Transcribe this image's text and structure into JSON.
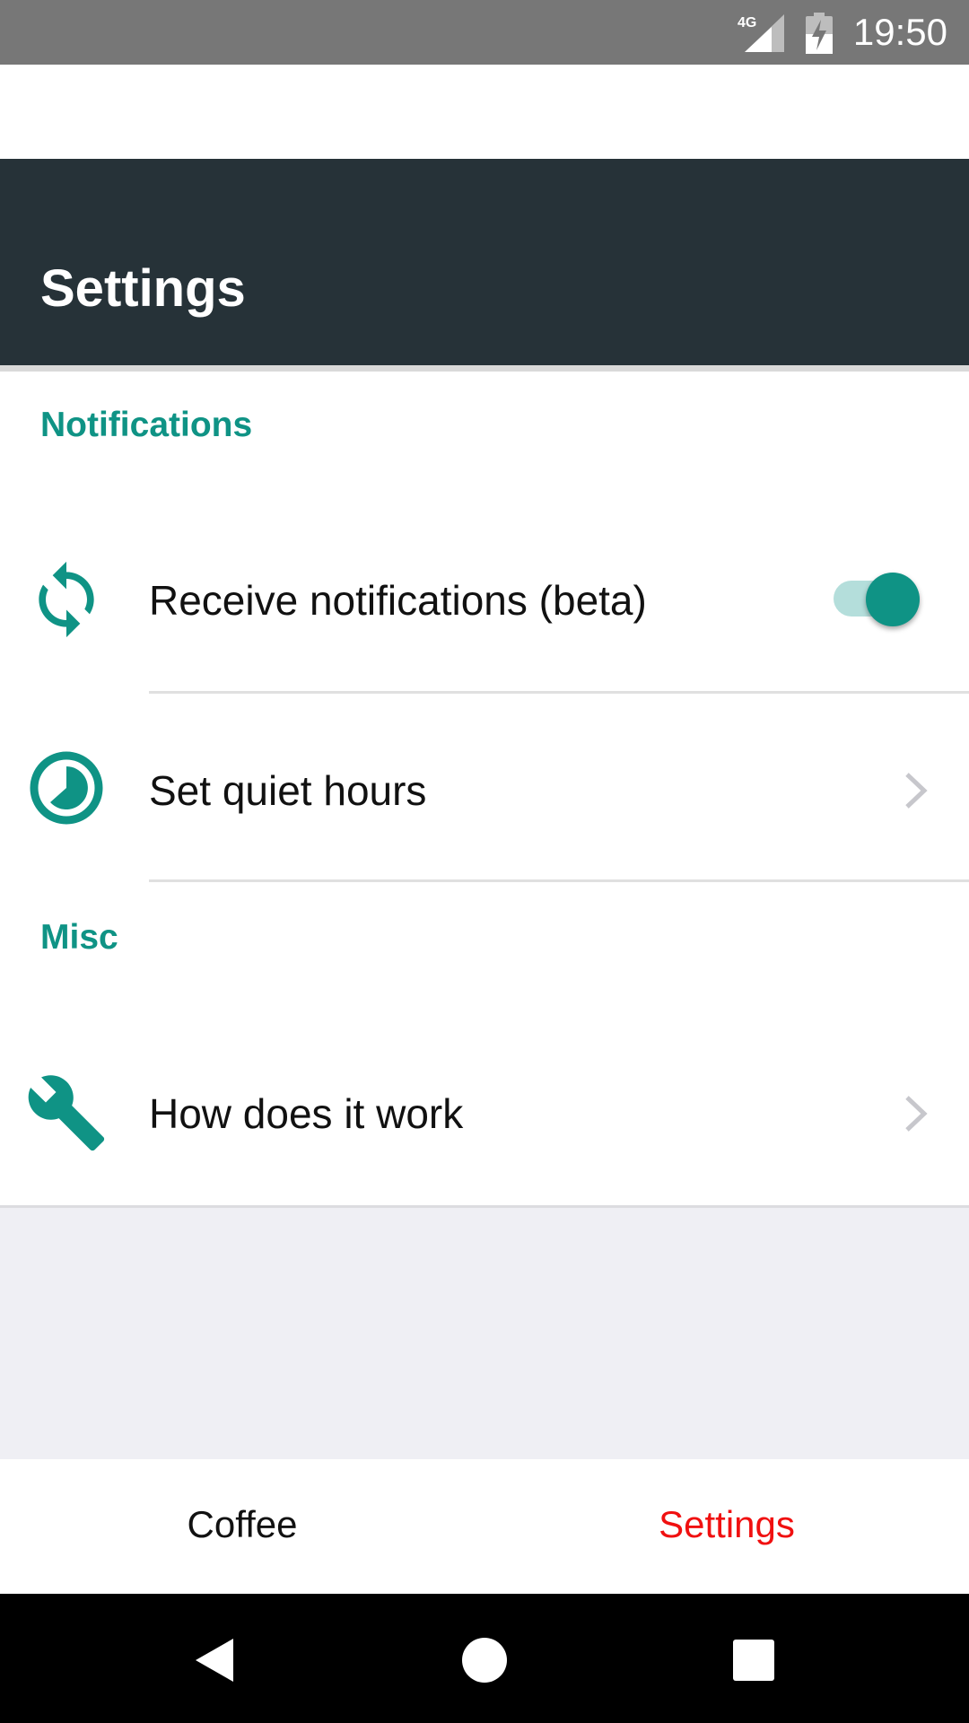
{
  "status_bar": {
    "network": "4G",
    "time": "19:50",
    "icons": [
      "signal-4g-icon",
      "battery-charging-icon"
    ]
  },
  "header": {
    "title": "Settings"
  },
  "sections": [
    {
      "title": "Notifications",
      "items": [
        {
          "icon": "sync-icon",
          "label": "Receive notifications (beta)",
          "control": "toggle",
          "toggle_on": true
        },
        {
          "icon": "clock-icon",
          "label": "Set quiet hours",
          "control": "chevron"
        }
      ]
    },
    {
      "title": "Misc",
      "items": [
        {
          "icon": "wrench-icon",
          "label": "How does it work",
          "control": "chevron"
        }
      ]
    }
  ],
  "tabs": [
    {
      "label": "Coffee",
      "active": false
    },
    {
      "label": "Settings",
      "active": true
    }
  ],
  "system_nav": [
    "back-icon",
    "home-icon",
    "recents-icon"
  ],
  "colors": {
    "accent": "#0f9385",
    "header_bg": "#263238",
    "status_bar_bg": "#777777",
    "active_tab": "#f01010",
    "inactive_tab": "#111111",
    "toggle_track": "#b4dedb",
    "empty_area_bg": "#efeff4"
  }
}
